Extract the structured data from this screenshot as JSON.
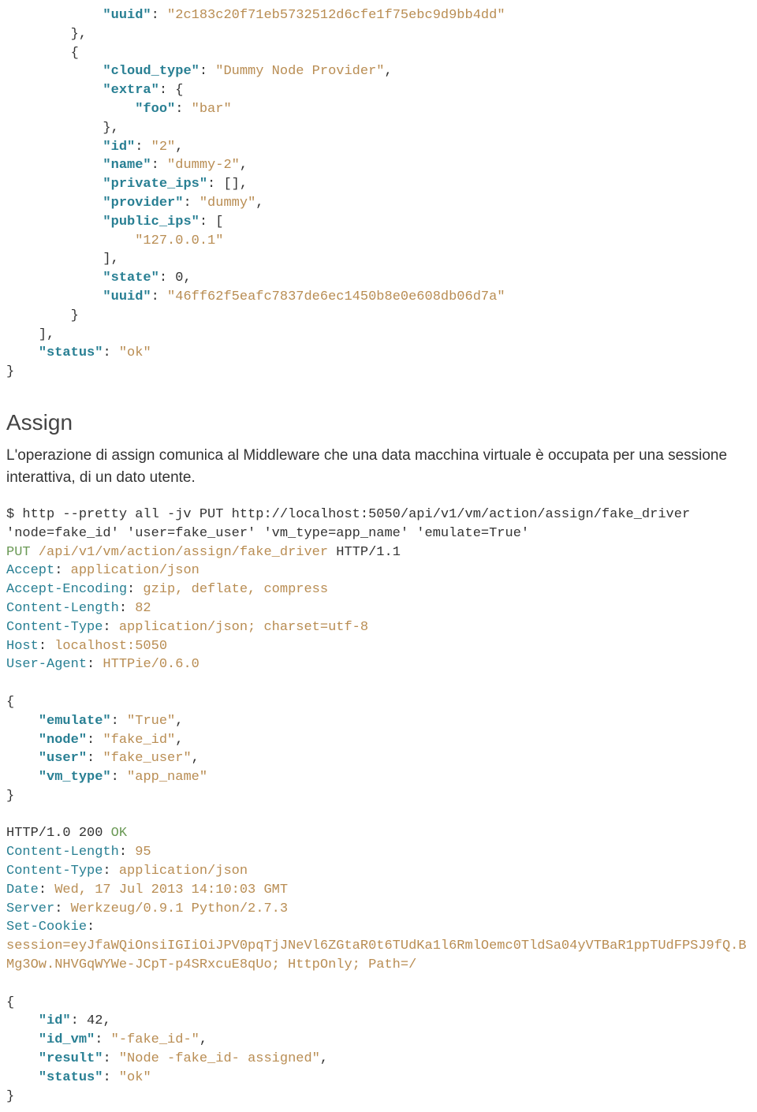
{
  "block1": {
    "uuid_key": "\"uuid\"",
    "uuid_val": "\"2c183c20f71eb5732512d6cfe1f75ebc9d9bb4dd\"",
    "cloud_type_key": "\"cloud_type\"",
    "cloud_type_val": "\"Dummy Node Provider\"",
    "extra_key": "\"extra\"",
    "foo_key": "\"foo\"",
    "foo_val": "\"bar\"",
    "id_key": "\"id\"",
    "id_val": "\"2\"",
    "name_key": "\"name\"",
    "name_val": "\"dummy-2\"",
    "private_ips_key": "\"private_ips\"",
    "provider_key": "\"provider\"",
    "provider_val": "\"dummy\"",
    "public_ips_key": "\"public_ips\"",
    "ip_val": "\"127.0.0.1\"",
    "state_key": "\"state\"",
    "state_val": "0",
    "uuid2_key": "\"uuid\"",
    "uuid2_val": "\"46ff62f5eafc7837de6ec1450b8e0e608db06d7a\"",
    "status_key": "\"status\"",
    "status_val": "\"ok\""
  },
  "heading": "Assign",
  "paragraph": "L'operazione di assign comunica al Middleware che una data macchina virtuale è occupata per una sessione interattiva, di un dato utente.",
  "block2": {
    "cmd1": "$ http --pretty all -jv PUT http://localhost:5050/api/v1/vm/action/assign/fake_driver",
    "cmd2": "'node=fake_id' 'user=fake_user' 'vm_type=app_name' 'emulate=True'",
    "method": "PUT",
    "path": " /api/v1/vm/action/assign/fake_driver ",
    "httpver": "HTTP/1.1",
    "h_accept_k": "Accept",
    "h_accept_v": " application/json",
    "h_ae_k": "Accept-Encoding",
    "h_ae_v": " gzip, deflate, compress",
    "h_cl_k": "Content-Length",
    "h_cl_v": " 82",
    "h_ct_k": "Content-Type",
    "h_ct_v": " application/json; charset=utf-8",
    "h_host_k": "Host",
    "h_host_v": " localhost:5050",
    "h_ua_k": "User-Agent",
    "h_ua_v": " HTTPie/0.6.0",
    "emulate_k": "\"emulate\"",
    "emulate_v": "\"True\"",
    "node_k": "\"node\"",
    "node_v": "\"fake_id\"",
    "user_k": "\"user\"",
    "user_v": "\"fake_user\"",
    "vmtype_k": "\"vm_type\"",
    "vmtype_v": "\"app_name\"",
    "resp_ver": "HTTP/1.0 200 ",
    "resp_ok": "OK",
    "r_cl_k": "Content-Length",
    "r_cl_v": " 95",
    "r_ct_k": "Content-Type",
    "r_ct_v": " application/json",
    "r_date_k": "Date",
    "r_date_v": " Wed, 17 Jul 2013 14:10:03 GMT",
    "r_server_k": "Server",
    "r_server_v": " Werkzeug/0.9.1 Python/2.7.3",
    "r_cookie_k": "Set-Cookie",
    "r_cookie_v": "session=eyJfaWQiOnsiIGIiOiJPV0pqTjJNeVl6ZGtaR0t6TUdKa1l6RmlOemc0TldSa04yVTBaR1ppTUdFPSJ9fQ.BMg3Ow.NHVGqWYWe-JCpT-p4SRxcuE8qUo; HttpOnly; Path=/",
    "rid_k": "\"id\"",
    "rid_v": "42",
    "ridvm_k": "\"id_vm\"",
    "ridvm_v": "\"-fake_id-\"",
    "rresult_k": "\"result\"",
    "rresult_v": "\"Node -fake_id- assigned\"",
    "rstatus_k": "\"status\"",
    "rstatus_v": "\"ok\""
  }
}
